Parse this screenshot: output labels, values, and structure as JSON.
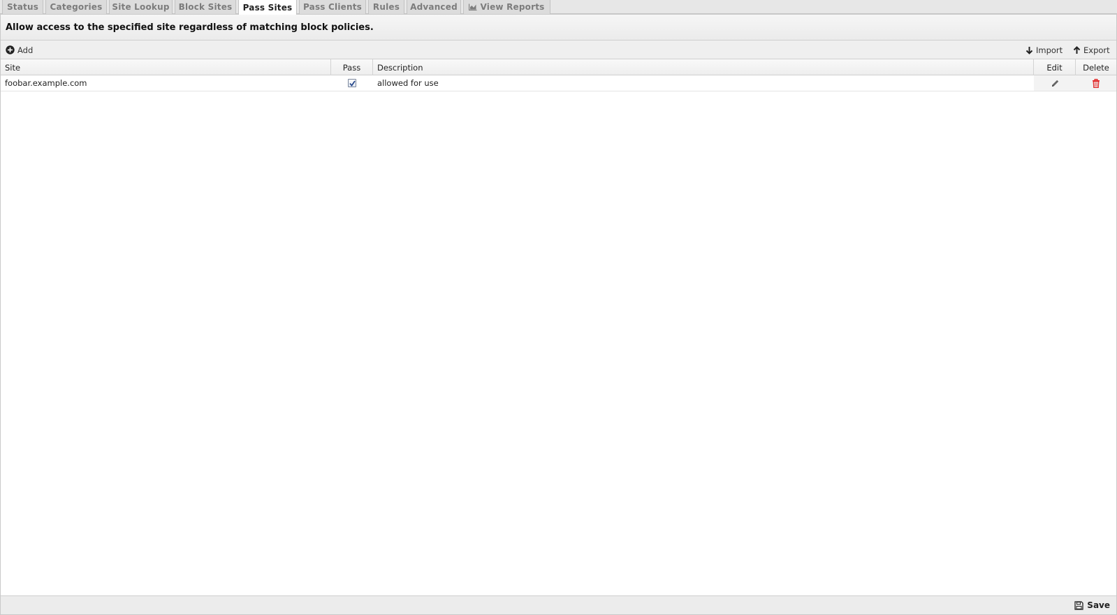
{
  "tabs": [
    {
      "label": "Status"
    },
    {
      "label": "Categories"
    },
    {
      "label": "Site Lookup"
    },
    {
      "label": "Block Sites"
    },
    {
      "label": "Pass Sites"
    },
    {
      "label": "Pass Clients"
    },
    {
      "label": "Rules"
    },
    {
      "label": "Advanced"
    },
    {
      "label": "View Reports",
      "icon": "chart-icon"
    }
  ],
  "active_tab": "Pass Sites",
  "description": "Allow access to the specified site regardless of matching block policies.",
  "toolbar": {
    "add_label": "Add",
    "import_label": "Import",
    "export_label": "Export"
  },
  "table": {
    "columns": {
      "site": "Site",
      "pass": "Pass",
      "description": "Description",
      "edit": "Edit",
      "delete": "Delete"
    },
    "rows": [
      {
        "site": "foobar.example.com",
        "pass": true,
        "description": "allowed for use"
      }
    ]
  },
  "footer": {
    "save_label": "Save"
  },
  "colors": {
    "delete_icon": "#e02020",
    "edit_icon": "#666666"
  }
}
